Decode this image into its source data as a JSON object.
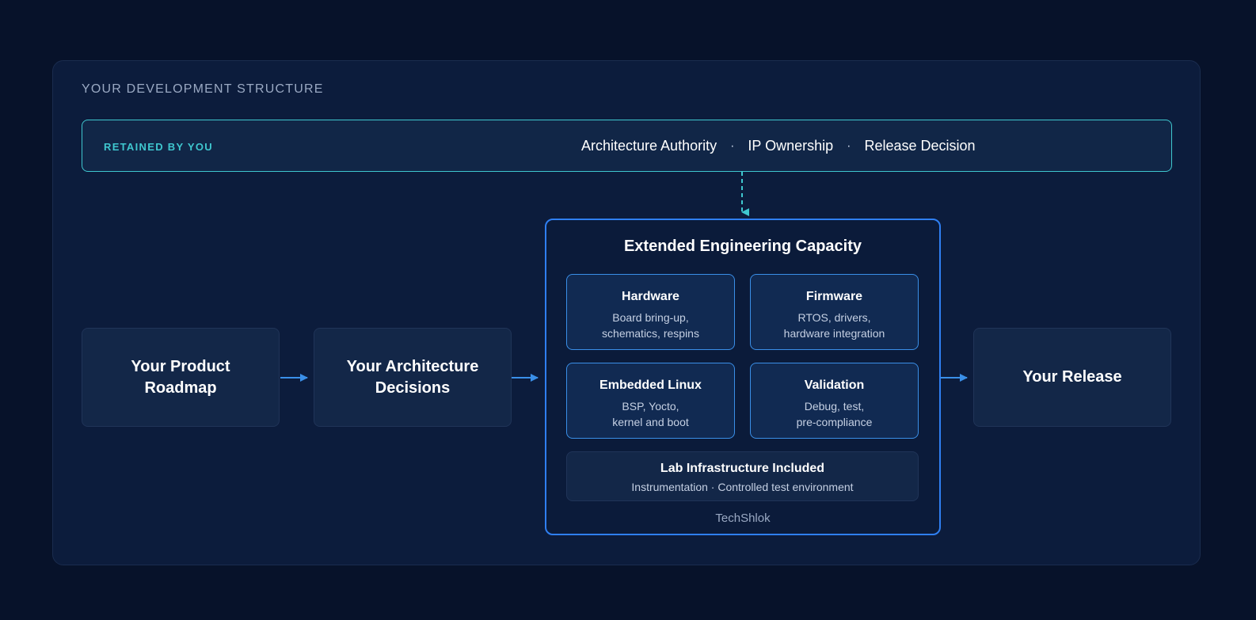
{
  "section_label": "YOUR DEVELOPMENT STRUCTURE",
  "retained": {
    "label": "RETAINED BY YOU",
    "items": [
      "Architecture Authority",
      "IP Ownership",
      "Release Decision"
    ],
    "separator": "·"
  },
  "flow": {
    "roadmap": "Your Product\nRoadmap",
    "architecture": "Your Architecture\nDecisions",
    "release": "Your Release"
  },
  "capacity": {
    "title": "Extended Engineering Capacity",
    "modules": [
      {
        "title": "Hardware",
        "desc": "Board bring-up,\nschematics, respins"
      },
      {
        "title": "Firmware",
        "desc": "RTOS, drivers,\nhardware integration"
      },
      {
        "title": "Embedded Linux",
        "desc": "BSP, Yocto,\nkernel and boot"
      },
      {
        "title": "Validation",
        "desc": "Debug, test,\npre-compliance"
      }
    ],
    "lab": {
      "title": "Lab Infrastructure Included",
      "desc": "Instrumentation · Controlled test environment"
    },
    "footer": "TechShlok"
  },
  "colors": {
    "background": "#07122a",
    "panel": "#0c1c3c",
    "accent_teal": "#3fc7cf",
    "accent_blue": "#2f7ff2",
    "text": "#ffffff"
  }
}
